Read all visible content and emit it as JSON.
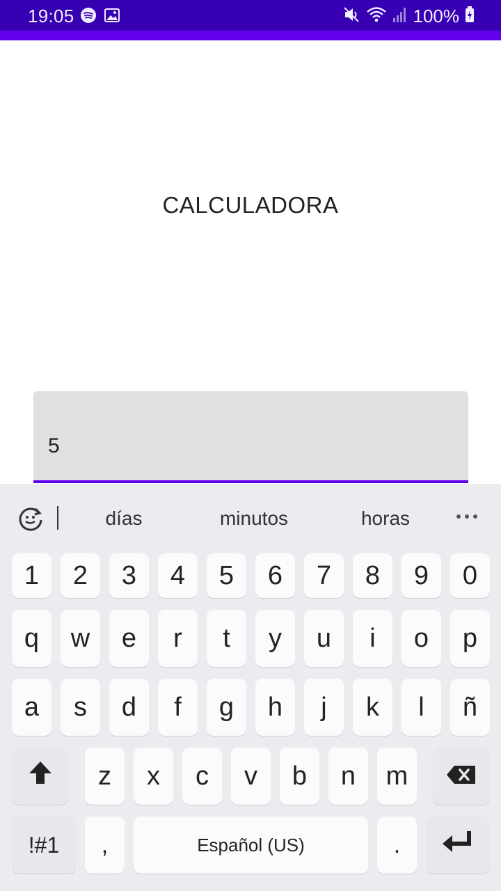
{
  "status_bar": {
    "time": "19:05",
    "battery": "100%",
    "icons": [
      "spotify-icon",
      "gallery-icon",
      "mute-icon",
      "wifi-icon",
      "signal-icon",
      "battery-charging-icon"
    ]
  },
  "colors": {
    "status_bar": "#3700b3",
    "accent": "#6200ee",
    "field_bg": "#e0e0e0",
    "keyboard_bg": "#eaecf0"
  },
  "app": {
    "title": "CALCULADORA"
  },
  "input": {
    "value": "5"
  },
  "keyboard": {
    "suggestions": [
      "días",
      "minutos",
      "horas"
    ],
    "number_row": [
      "1",
      "2",
      "3",
      "4",
      "5",
      "6",
      "7",
      "8",
      "9",
      "0"
    ],
    "row1": [
      "q",
      "w",
      "e",
      "r",
      "t",
      "y",
      "u",
      "i",
      "o",
      "p"
    ],
    "row2": [
      "a",
      "s",
      "d",
      "f",
      "g",
      "h",
      "j",
      "k",
      "l",
      "ñ"
    ],
    "row3": [
      "z",
      "x",
      "c",
      "v",
      "b",
      "n",
      "m"
    ],
    "symbols_label": "!#1",
    "comma_label": ",",
    "space_label": "Español (US)",
    "period_label": "."
  }
}
